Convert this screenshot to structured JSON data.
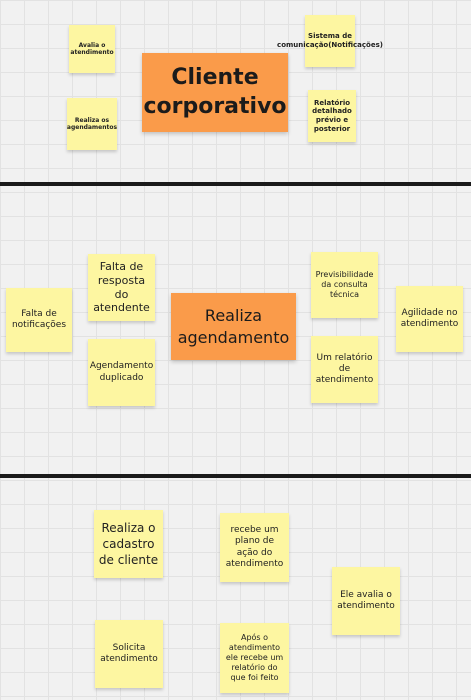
{
  "section1": {
    "center": "Cliente corporativo",
    "notes": [
      "Avalia o atendimento",
      "Realiza os agendamentos",
      "Sistema de comunicação(Notificações)",
      "Relatório detalhado prévio e posterior"
    ]
  },
  "section2": {
    "center": "Realiza agendamento",
    "notes": [
      "Falta de notificações",
      "Falta de resposta do atendente",
      "Agendamento duplicado",
      "Previsibilidade da consulta técnica",
      "Um relatório de atendimento",
      "Agilidade no atendimento"
    ]
  },
  "section3": {
    "notes": [
      "Realiza o cadastro de cliente",
      "recebe um plano de ação do atendimento",
      "Ele avalia o atendimento",
      "Solicita atendimento",
      "Após o atendimento ele recebe um relatório do que foi feito"
    ]
  }
}
